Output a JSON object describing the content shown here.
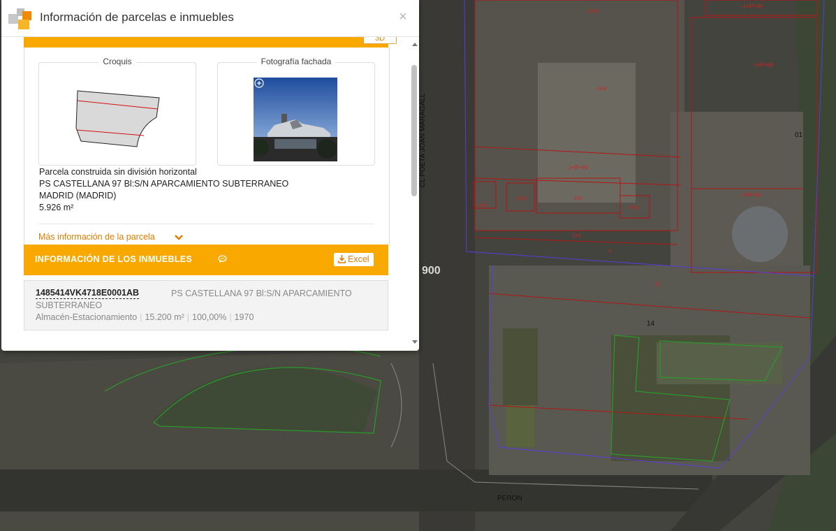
{
  "dialog": {
    "title": "Información de parcelas e inmuebles",
    "close_symbol": "×",
    "button_3d": "3D"
  },
  "parcel": {
    "croquis_label": "Croquis",
    "fachada_label": "Fotografía fachada",
    "type": "Parcela construida sin división horizontal",
    "address": "PS CASTELLANA 97 Bl:S/N APARCAMIENTO SUBTERRANEO",
    "city": "MADRID (MADRID)",
    "area": "5.926 m²",
    "more_info": "Más información de la parcela"
  },
  "inmuebles": {
    "title": "INFORMACIÓN DE LOS INMUEBLES",
    "excel_label": "Excel",
    "items": [
      {
        "ref": "1485414VK4718E0001AB",
        "address_part1": "PS CASTELLANA 97 Bl:S/N APARCAMIENTO",
        "address_part2": "SUBTERRANEO",
        "use": "Almacén-Estacionamiento",
        "area": "15.200 m²",
        "share": "100,00%",
        "year": "1970"
      }
    ]
  },
  "map": {
    "labels": {
      "street_maragall": "CL POETA JOAN MARAGALL",
      "street_peron": "PERON",
      "num_01": "01",
      "num_14": "14",
      "num_00": "900",
      "f1": "-I+II",
      "f2": "-I+P+III",
      "f3": "-I+V",
      "f4": "-I+P+IV",
      "f5": "-I+V",
      "f6": "-I+I",
      "f7": "-I+V",
      "f8": "-I+V",
      "f9": "-I+P+III",
      "f10": "-I+I",
      "f11": "-I",
      "f12": "-II",
      "f13": "-I+P+IV",
      "f14": "-I+P+III"
    }
  }
}
